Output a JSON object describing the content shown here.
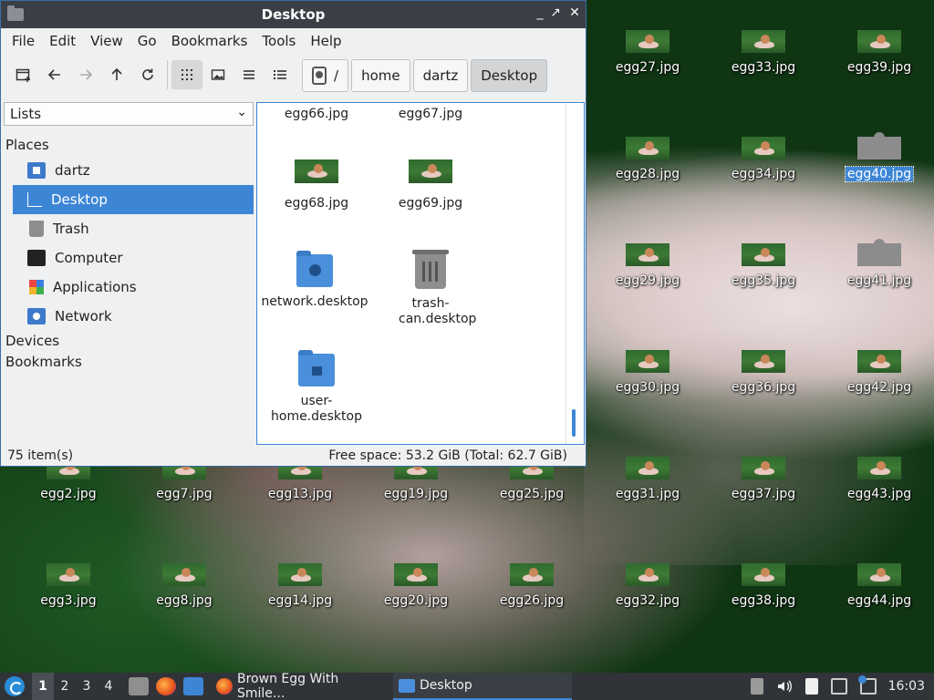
{
  "window": {
    "title": "Desktop",
    "controls": {
      "minimize": "_",
      "maximize": "↗",
      "close": "✕"
    }
  },
  "menu": [
    "File",
    "Edit",
    "View",
    "Go",
    "Bookmarks",
    "Tools",
    "Help"
  ],
  "toolbar": {
    "icons": [
      "new-tab-icon",
      "back-arrow-icon",
      "forward-arrow-icon",
      "up-arrow-icon",
      "reload-icon",
      "icon-view-icon",
      "thumbnail-view-icon",
      "compact-view-icon",
      "detailed-list-view-icon"
    ],
    "path_root": "/",
    "path": [
      "home",
      "dartz",
      "Desktop"
    ]
  },
  "sidebar": {
    "mode": "Lists",
    "places_header": "Places",
    "places": [
      {
        "label": "dartz",
        "icon": "home-folder-icon"
      },
      {
        "label": "Desktop",
        "icon": "desktop-icon",
        "selected": true
      },
      {
        "label": "Trash",
        "icon": "trash-icon"
      },
      {
        "label": "Computer",
        "icon": "computer-icon"
      },
      {
        "label": "Applications",
        "icon": "applications-icon"
      },
      {
        "label": "Network",
        "icon": "network-icon"
      }
    ],
    "devices_header": "Devices",
    "bookmarks_header": "Bookmarks"
  },
  "files": [
    {
      "name": "egg66.jpg",
      "type": "image"
    },
    {
      "name": "egg67.jpg",
      "type": "image"
    },
    {
      "name": "egg68.jpg",
      "type": "image"
    },
    {
      "name": "egg69.jpg",
      "type": "image"
    },
    {
      "name": "network.desktop",
      "type": "network-folder"
    },
    {
      "name": "trash-can.desktop",
      "type": "trash"
    },
    {
      "name": "user-home.desktop",
      "type": "home-folder"
    }
  ],
  "status": {
    "items": "75 item(s)",
    "free_space": "Free space: 53.2 GiB (Total: 62.7 GiB)"
  },
  "desktop_icons": {
    "col1": [
      "egg2.jpg",
      "egg3.jpg"
    ],
    "col2": [
      "egg7.jpg",
      "egg8.jpg"
    ],
    "col3": [
      "egg13.jpg",
      "egg14.jpg"
    ],
    "col4": [
      "egg19.jpg",
      "egg20.jpg"
    ],
    "col5": [
      "egg25.jpg",
      "egg26.jpg"
    ],
    "col6": [
      "egg27.jpg",
      "egg28.jpg",
      "egg29.jpg",
      "egg30.jpg",
      "egg31.jpg",
      "egg32.jpg"
    ],
    "col7": [
      "egg33.jpg",
      "egg34.jpg",
      "egg35.jpg",
      "egg36.jpg",
      "egg37.jpg",
      "egg38.jpg"
    ],
    "col8": [
      "egg39.jpg",
      "egg40.jpg",
      "egg41.jpg",
      "egg42.jpg",
      "egg43.jpg",
      "egg44.jpg"
    ],
    "selected": "egg40.jpg"
  },
  "taskbar": {
    "workspaces": [
      "1",
      "2",
      "3",
      "4"
    ],
    "active_workspace": "1",
    "tasks": [
      {
        "label": "Brown Egg With Smile...",
        "icon": "firefox-icon"
      },
      {
        "label": "Desktop",
        "icon": "folder-icon",
        "active": true
      }
    ],
    "clock": "16:03"
  },
  "colors": {
    "accent": "#3d86d6",
    "titlebar": "#3a3f46",
    "taskbar": "#303438"
  }
}
